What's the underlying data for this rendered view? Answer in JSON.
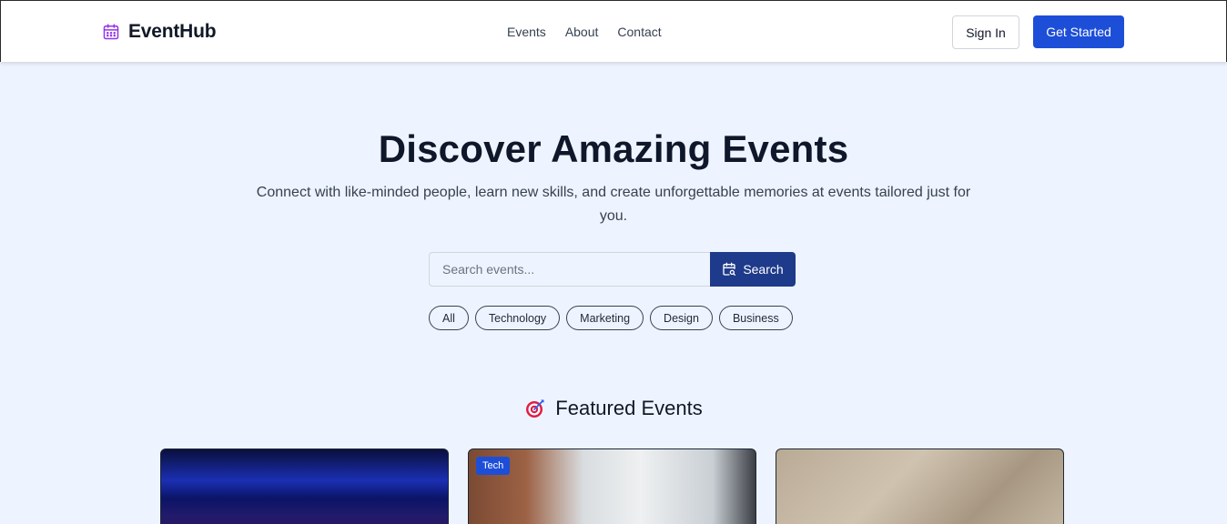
{
  "brand": {
    "name": "EventHub",
    "icon": "calendar-icon"
  },
  "nav": {
    "events": "Events",
    "about": "About",
    "contact": "Contact"
  },
  "auth": {
    "sign_in": "Sign In",
    "get_started": "Get Started"
  },
  "hero": {
    "title": "Discover Amazing Events",
    "subtitle": "Connect with like-minded people, learn new skills, and create unforgettable memories at events tailored just for you."
  },
  "search": {
    "placeholder": "Search events...",
    "button_label": "Search",
    "button_icon": "calendar-search-icon"
  },
  "categories": [
    "All",
    "Technology",
    "Marketing",
    "Design",
    "Business"
  ],
  "featured": {
    "icon": "target-icon",
    "title": "Featured Events"
  },
  "cards": [
    {
      "tag": ""
    },
    {
      "tag": "Tech"
    },
    {
      "tag": ""
    }
  ],
  "colors": {
    "primary": "#1d4ed8",
    "search_button": "#1e3a8a",
    "background": "#eef4ff",
    "brand_icon": "#9333ea"
  }
}
